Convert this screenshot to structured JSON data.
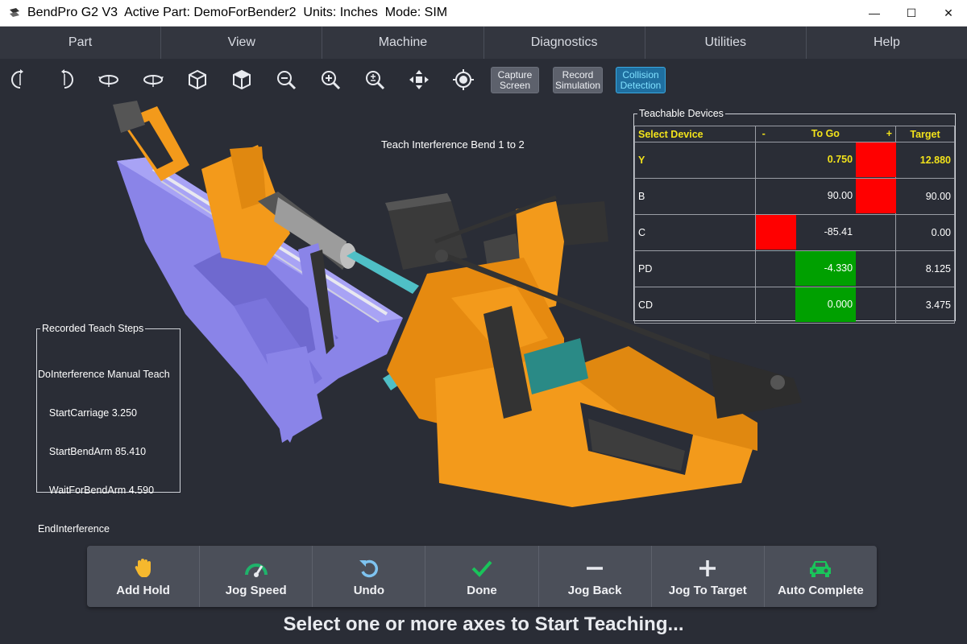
{
  "window": {
    "title": "BendPro G2 V3  Active Part: DemoForBender2  Units: Inches  Mode: SIM",
    "minimize": "—",
    "maximize": "☐",
    "close": "✕"
  },
  "menu": [
    "Part",
    "View",
    "Machine",
    "Diagnostics",
    "Utilities",
    "Help"
  ],
  "toolbar": {
    "icons": [
      "rotate-left-icon",
      "rotate-right-icon",
      "orbit-left-icon",
      "orbit-right-icon",
      "cube-view-icon",
      "cube-iso-icon",
      "zoom-out-icon",
      "zoom-in-icon",
      "zoom-fit-icon",
      "pan-icon",
      "center-target-icon"
    ],
    "buttons": [
      {
        "label": "Capture Screen",
        "active": false
      },
      {
        "label": "Record Simulation",
        "active": false
      },
      {
        "label": "Collision Detection",
        "active": true
      }
    ]
  },
  "viewport": {
    "interference_label": "Teach Interference Bend 1 to 2"
  },
  "devices": {
    "title": "Teachable Devices",
    "header": {
      "select": "Select Device",
      "minus": "-",
      "togo": "To Go",
      "plus": "+",
      "target": "Target"
    },
    "rows": [
      {
        "name": "Y",
        "togo": "0.750",
        "target": "12.880",
        "highlight": true,
        "bar": "red",
        "bar_side": "plus"
      },
      {
        "name": "B",
        "togo": "90.00",
        "target": "90.00",
        "highlight": false,
        "bar": "red",
        "bar_side": "plus"
      },
      {
        "name": "C",
        "togo": "-85.41",
        "target": "0.00",
        "highlight": false,
        "bar": "red",
        "bar_side": "minus"
      },
      {
        "name": "PD",
        "togo": "-4.330",
        "target": "8.125",
        "highlight": false,
        "bar": "green",
        "bar_side": "center"
      },
      {
        "name": "CD",
        "togo": "0.000",
        "target": "3.475",
        "highlight": false,
        "bar": "green",
        "bar_side": "center"
      }
    ],
    "colors": {
      "red": "#ff0000",
      "green": "#00a000",
      "highlight": "#f2e21b"
    }
  },
  "steps": {
    "title": "Recorded Teach Steps",
    "lines": [
      "DoInterference Manual Teach",
      "    StartCarriage 3.250",
      "    StartBendArm 85.410",
      "    WaitForBendArm 4.590",
      "EndInterference"
    ]
  },
  "actions": [
    {
      "label": "Add Hold",
      "icon": "hand-icon"
    },
    {
      "label": "Jog Speed",
      "icon": "speedometer-icon"
    },
    {
      "label": "Undo",
      "icon": "undo-icon"
    },
    {
      "label": "Done",
      "icon": "checkmark-icon"
    },
    {
      "label": "Jog Back",
      "icon": "minus-icon"
    },
    {
      "label": "Jog To Target",
      "icon": "plus-icon"
    },
    {
      "label": "Auto Complete",
      "icon": "car-icon"
    }
  ],
  "status_message": "Select one or more axes to Start Teaching..."
}
